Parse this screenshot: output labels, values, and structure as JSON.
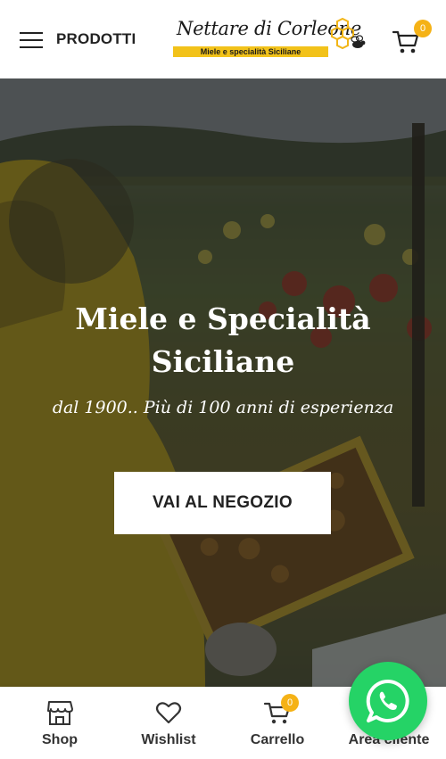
{
  "header": {
    "menu_label": "PRODOTTI",
    "logo": {
      "title": "Nettare di Corleone",
      "subtitle": "Miele e specialità Siciliane"
    },
    "cart_count": "0"
  },
  "hero": {
    "title": "Miele e Specialità Siciliane",
    "subtitle": "dal 1900.. Più di 100 anni di esperienza",
    "cta_label": "VAI AL NEGOZIO"
  },
  "bottom_bar": {
    "items": [
      {
        "label": "Shop",
        "icon": "shop-icon"
      },
      {
        "label": "Wishlist",
        "icon": "heart-icon"
      },
      {
        "label": "Carrello",
        "icon": "cart-icon",
        "count": "0"
      },
      {
        "label": "Area cliente",
        "icon": "user-icon"
      }
    ]
  },
  "colors": {
    "accent": "#f5b216",
    "logo_band": "#f2c21a",
    "whatsapp": "#25d366",
    "text": "#222222"
  },
  "whatsapp": {
    "icon": "whatsapp-icon"
  }
}
